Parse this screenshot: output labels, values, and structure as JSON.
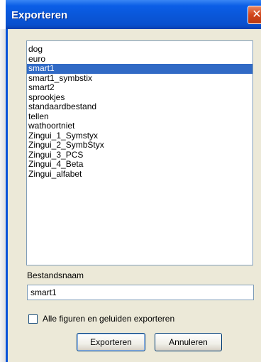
{
  "window": {
    "title": "Exporteren",
    "close_glyph": "✕"
  },
  "list": {
    "items": [
      {
        "label": "dog",
        "selected": false
      },
      {
        "label": "euro",
        "selected": false
      },
      {
        "label": "smart1",
        "selected": true
      },
      {
        "label": "smart1_symbstix",
        "selected": false
      },
      {
        "label": "smart2",
        "selected": false
      },
      {
        "label": "sprookjes",
        "selected": false
      },
      {
        "label": "standaardbestand",
        "selected": false
      },
      {
        "label": "tellen",
        "selected": false
      },
      {
        "label": "wathoortniet",
        "selected": false
      },
      {
        "label": "Zingui_1_Symstyx",
        "selected": false
      },
      {
        "label": "Zingui_2_SymbStyx",
        "selected": false
      },
      {
        "label": "Zingui_3_PCS",
        "selected": false
      },
      {
        "label": "Zingui_4_Beta",
        "selected": false
      },
      {
        "label": "Zingui_alfabet",
        "selected": false
      }
    ]
  },
  "filename": {
    "label": "Bestandsnaam",
    "value": "smart1"
  },
  "checkbox": {
    "label": "Alle figuren en geluiden exporteren",
    "checked": false
  },
  "buttons": {
    "export": "Exporteren",
    "cancel": "Annuleren"
  },
  "colors": {
    "titlebar": "#0a56d8",
    "selection": "#316ac5",
    "dialog_bg": "#ece9d8"
  }
}
